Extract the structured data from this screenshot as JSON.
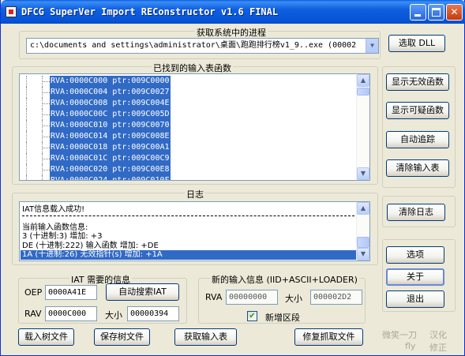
{
  "window": {
    "title": "DFCG SuperVer Import REConstructor v1.6 FINAL"
  },
  "process_group": {
    "label": "获取系统中的进程",
    "selected_process": "c:\\documents and settings\\administrator\\桌面\\跑跑排行榜v1_9..exe (00002",
    "pick_dll_button": "选取 DLL"
  },
  "imports_group": {
    "label": "已找到的输入表函数",
    "rows": [
      "RVA:0000C000 ptr:009C0000",
      "RVA:0000C004 ptr:009C0027",
      "RVA:0000C008 ptr:009C004E",
      "RVA:0000C00C ptr:009C005D",
      "RVA:0000C010 ptr:009C0070",
      "RVA:0000C014 ptr:009C008E",
      "RVA:0000C018 ptr:009C00A1",
      "RVA:0000C01C ptr:009C00C9",
      "RVA:0000C020 ptr:009C00E8",
      "RVA:0000C024 ptr:009C010F"
    ]
  },
  "side_buttons": {
    "show_invalid": "显示无效函数",
    "show_suspect": "显示可疑函数",
    "auto_trace": "自动追踪",
    "clear_imports": "清除输入表",
    "clear_log": "清除日志",
    "options": "选项",
    "about": "关于",
    "exit": "退出"
  },
  "log_group": {
    "label": "日志",
    "lines": [
      "IAT信息载入成功!",
      "当前输入函数信息:",
      "3 (十进制:3)  增加: +3",
      "DE (十进制:222) 输入函数  增加: +DE",
      "1A (十进制:26)  无效指针(s)  增加: +1A"
    ]
  },
  "iat_group": {
    "label": "IAT 需要的信息",
    "oep_label": "OEP",
    "oep_value": "0000A41E",
    "auto_search_button": "自动搜索IAT",
    "rva_label": "RAV",
    "rva_value": "0000C000",
    "size_label": "大小",
    "size_value": "00000394"
  },
  "new_import_group": {
    "label": "新的输入信息 (IID+ASCII+LOADER)",
    "rva_label": "RVA",
    "rva_value": "00000000",
    "size_label": "大小",
    "size_value": "000002D2",
    "add_section_label": "新增区段",
    "add_section_checked": true
  },
  "bottom_buttons": {
    "load_tree": "载入树文件",
    "save_tree": "保存树文件",
    "get_imports": "获取输入表",
    "fix_dump": "修复抓取文件"
  },
  "credits": {
    "line1_a": "微笑一刀",
    "line1_b": "汉化",
    "line2_a": "fly",
    "line2_b": "修正"
  }
}
